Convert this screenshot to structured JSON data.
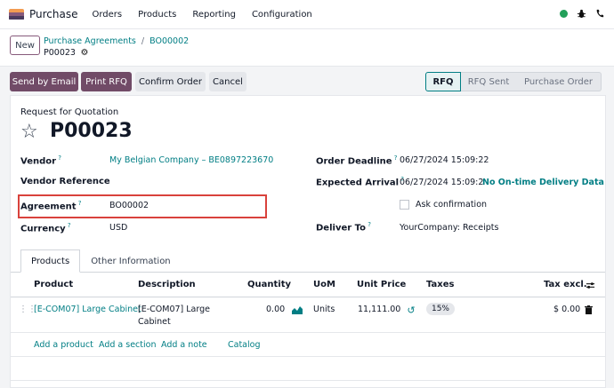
{
  "topbar": {
    "app_name": "Purchase",
    "menu": [
      "Orders",
      "Products",
      "Reporting",
      "Configuration"
    ]
  },
  "control": {
    "new_label": "New",
    "breadcrumb_parent": "Purchase Agreements",
    "breadcrumb_sep": "/",
    "breadcrumb_current": "BO00002",
    "record_name": "P00023"
  },
  "actions": {
    "send_email": "Send by Email",
    "print_rfq": "Print RFQ",
    "confirm_order": "Confirm Order",
    "cancel": "Cancel"
  },
  "status": [
    "RFQ",
    "RFQ Sent",
    "Purchase Order"
  ],
  "form": {
    "doc_type": "Request for Quotation",
    "title": "P00023",
    "vendor_label": "Vendor",
    "vendor_value": "My Belgian Company – BE0897223670",
    "vendor_ref_label": "Vendor Reference",
    "agreement_label": "Agreement",
    "agreement_value": "BO00002",
    "currency_label": "Currency",
    "currency_value": "USD",
    "deadline_label": "Order Deadline",
    "deadline_value": "06/27/2024 15:09:22",
    "expected_label": "Expected Arrival",
    "expected_value": "06/27/2024 15:09:2",
    "on_time": "No On-time Delivery Data",
    "ask_confirmation": "Ask confirmation",
    "deliver_label": "Deliver To",
    "deliver_value": "YourCompany: Receipts"
  },
  "tabs": [
    "Products",
    "Other Information"
  ],
  "table": {
    "headers": [
      "Product",
      "Description",
      "Quantity",
      "UoM",
      "Unit Price",
      "Taxes",
      "Tax excl."
    ],
    "row": {
      "product": "[E-COM07] Large Cabinet",
      "description_1": "[E-COM07] Large",
      "description_2": "Cabinet",
      "quantity": "0.00",
      "uom": "Units",
      "unit_price": "11,111.00",
      "tax": "15%",
      "subtotal": "$ 0.00"
    },
    "add_links": [
      "Add a product",
      "Add a section",
      "Add a note",
      "Catalog"
    ]
  }
}
